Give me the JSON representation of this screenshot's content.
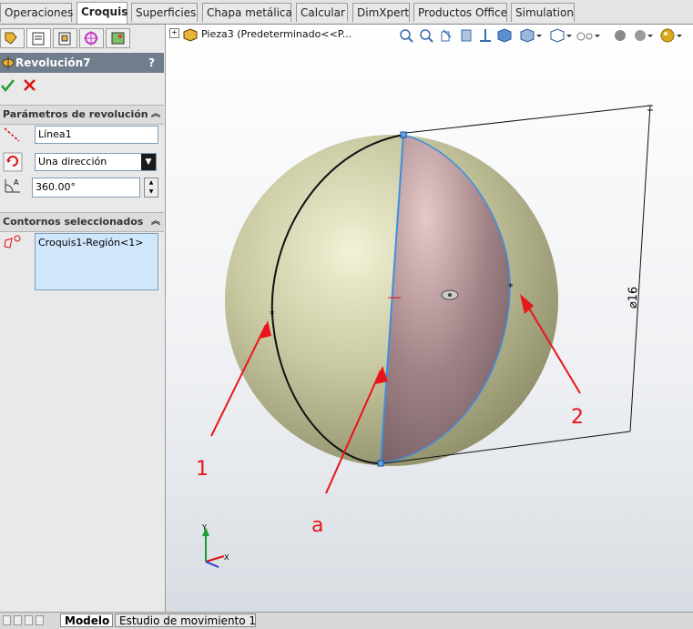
{
  "tabs": [
    "Operaciones",
    "Croquis",
    "Superficies",
    "Chapa metálica",
    "Calcular",
    "DimXpert",
    "Productos Office",
    "Simulation"
  ],
  "active_tab": "Croquis",
  "feature": {
    "title": "Revolución7",
    "help": "?"
  },
  "rev_params": {
    "header": "Parámetros de revolución",
    "axis_value": "Línea1",
    "direction_value": "Una dirección",
    "angle_value": "360.00°"
  },
  "contours": {
    "header": "Contornos seleccionados",
    "items": [
      "Croquis1-Región<1>"
    ]
  },
  "viewport": {
    "tree_label": "Pieza3  (Predeterminado<<P...",
    "dimension": "⌀16",
    "annotations": [
      "1",
      "a",
      "2"
    ]
  },
  "bottom_tabs": [
    "Modelo",
    "Estudio de movimiento 1"
  ],
  "colors": {
    "accent_red": "#e8161b",
    "header_bg": "#6f7d8c",
    "list_bg": "#cfe6fb",
    "sphere": "#c8c8a0",
    "revolve_face": "#9b7f82"
  }
}
